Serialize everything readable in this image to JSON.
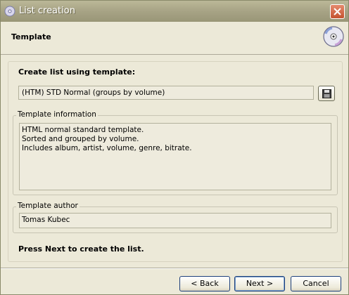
{
  "window": {
    "title": "List creation"
  },
  "header": {
    "title": "Template",
    "icon": "disc-icon"
  },
  "main": {
    "create_label": "Create list using template:",
    "template_selected": "(HTM) STD Normal (groups by volume)",
    "save_icon": "floppy-disk-icon",
    "info_group_label": "Template information",
    "info_lines": [
      "HTML normal standard template.",
      "Sorted and grouped by volume.",
      "Includes album, artist, volume, genre, bitrate."
    ],
    "author_group_label": "Template author",
    "author_name": "Tomas Kubec",
    "instruction": "Press Next to create the list."
  },
  "buttons": {
    "back": "< Back",
    "next": "Next >",
    "cancel": "Cancel"
  }
}
